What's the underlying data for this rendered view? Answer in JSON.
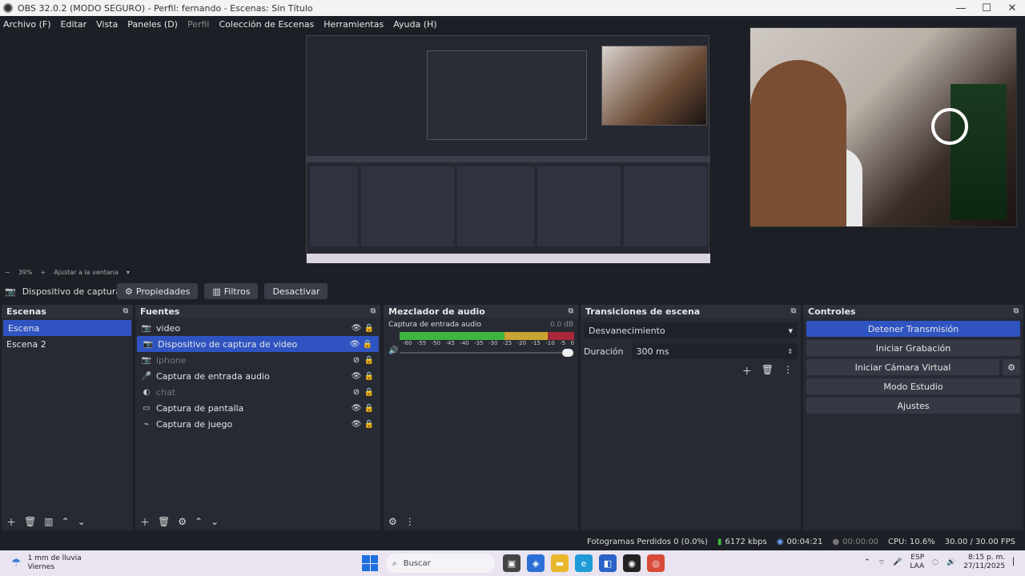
{
  "window": {
    "title": "OBS 32.0.2 (MODO SEGURO) - Perfil: fernando - Escenas: Sin Título",
    "min": "—",
    "max": "☐",
    "close": "✕"
  },
  "menu": [
    "Archivo (F)",
    "Editar",
    "Vista",
    "Paneles (D)",
    "Perfil",
    "Colección de Escenas",
    "Herramientas",
    "Ayuda (H)"
  ],
  "zoom": {
    "minus": "−",
    "value": "39%",
    "plus": "+",
    "fit": "Ajustar a la ventana",
    "arrow": "▾"
  },
  "source_toolbar": {
    "source_name": "Dispositivo de captura de v",
    "properties": "Propiedades",
    "filters": "Filtros",
    "deactivate": "Desactivar"
  },
  "scenes": {
    "title": "Escenas",
    "items": [
      "Escena",
      "Escena 2"
    ],
    "selected": 0
  },
  "sources": {
    "title": "Fuentes",
    "items": [
      {
        "label": "video",
        "icon": "camera-icon",
        "dim": false,
        "eye": "👁",
        "lock": "🔒"
      },
      {
        "label": "Dispositivo de captura de video",
        "icon": "camera-icon",
        "dim": false,
        "eye": "👁",
        "lock": "🔒"
      },
      {
        "label": "iphone",
        "icon": "camera-icon",
        "dim": true,
        "eye": "⊘",
        "lock": "🔒"
      },
      {
        "label": "Captura de entrada audio",
        "icon": "microphone-icon",
        "dim": false,
        "eye": "👁",
        "lock": "🔒"
      },
      {
        "label": "chat",
        "icon": "globe-icon",
        "dim": true,
        "eye": "⊘",
        "lock": "🔒"
      },
      {
        "label": "Captura de pantalla",
        "icon": "monitor-icon",
        "dim": false,
        "eye": "👁",
        "lock": "🔒"
      },
      {
        "label": "Captura de juego",
        "icon": "gamepad-icon",
        "dim": false,
        "eye": "👁",
        "lock": "🔒"
      }
    ],
    "selected": 1
  },
  "mixer": {
    "title": "Mezclador de audio",
    "track": "Captura de entrada audio",
    "db": "0.0 dB",
    "ticks": [
      "-60",
      "-55",
      "-50",
      "-45",
      "-40",
      "-35",
      "-30",
      "-25",
      "-20",
      "-15",
      "-10",
      "-5",
      "0"
    ],
    "level": 1.0
  },
  "transitions": {
    "title": "Transiciones de escena",
    "selected": "Desvanecimiento",
    "duration_label": "Duración",
    "duration_value": "300 ms"
  },
  "controls": {
    "title": "Controles",
    "stop_stream": "Detener Transmisión",
    "start_rec": "Iniciar Grabación",
    "virtual_cam": "Iniciar Cámara Virtual",
    "studio": "Modo Estudio",
    "settings": "Ajustes"
  },
  "status": {
    "dropped": "Fotogramas Perdidos 0 (0.0%)",
    "bitrate": "6172 kbps",
    "stream_time": "00:04:21",
    "rec_time": "00:00:00",
    "cpu": "CPU: 10.6%",
    "fps": "30.00 / 30.00 FPS"
  },
  "taskbar": {
    "weather_line1": "1 mm de lluvia",
    "weather_line2": "Viernes",
    "search": "Buscar",
    "lang1": "ESP",
    "lang2": "LAA",
    "time": "8:15 p. m.",
    "date": "27/11/2025"
  },
  "colors": {
    "accent": "#2f54c2",
    "panel": "#272a33",
    "bg": "#1d1f26"
  }
}
